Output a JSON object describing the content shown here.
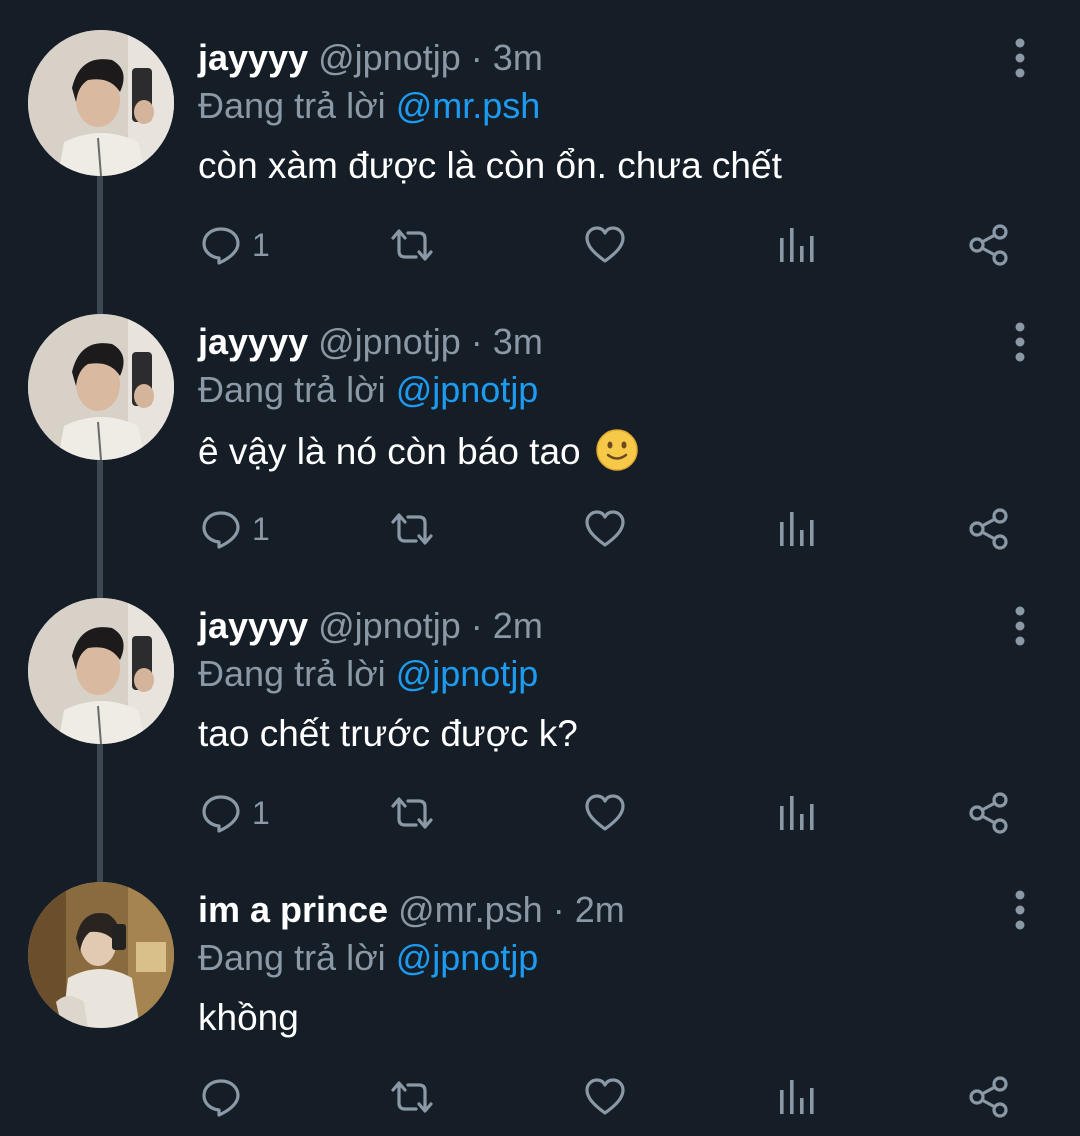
{
  "colors": {
    "background": "#151d27",
    "text_primary": "#ffffff",
    "text_secondary": "#8b98a5",
    "link": "#1d9bf0",
    "thread_line": "#3e4852"
  },
  "icons": {
    "reply": "speech-bubble-icon",
    "retweet": "retweet-icon",
    "like": "heart-icon",
    "views": "bar-chart-icon",
    "share": "share-icon",
    "more": "vertical-dots-icon"
  },
  "tweets": [
    {
      "display_name": "jayyyy",
      "handle": "@jpnotjp",
      "separator": "·",
      "time": "3m",
      "reply_prefix": "Đang trả lời",
      "reply_to": "@mr.psh",
      "text": "còn xàm được là còn ổn. chưa chết",
      "reply_count": "1"
    },
    {
      "display_name": "jayyyy",
      "handle": "@jpnotjp",
      "separator": "·",
      "time": "3m",
      "reply_prefix": "Đang trả lời",
      "reply_to": "@jpnotjp",
      "text": "ê vậy là nó còn báo tao",
      "reply_count": "1"
    },
    {
      "display_name": "jayyyy",
      "handle": "@jpnotjp",
      "separator": "·",
      "time": "2m",
      "reply_prefix": "Đang trả lời",
      "reply_to": "@jpnotjp",
      "text": "tao chết trước được k?",
      "reply_count": "1"
    },
    {
      "display_name": "im a prince",
      "handle": "@mr.psh",
      "separator": "·",
      "time": "2m",
      "reply_prefix": "Đang trả lời",
      "reply_to": "@jpnotjp",
      "text": "khồng",
      "reply_count": ""
    }
  ]
}
